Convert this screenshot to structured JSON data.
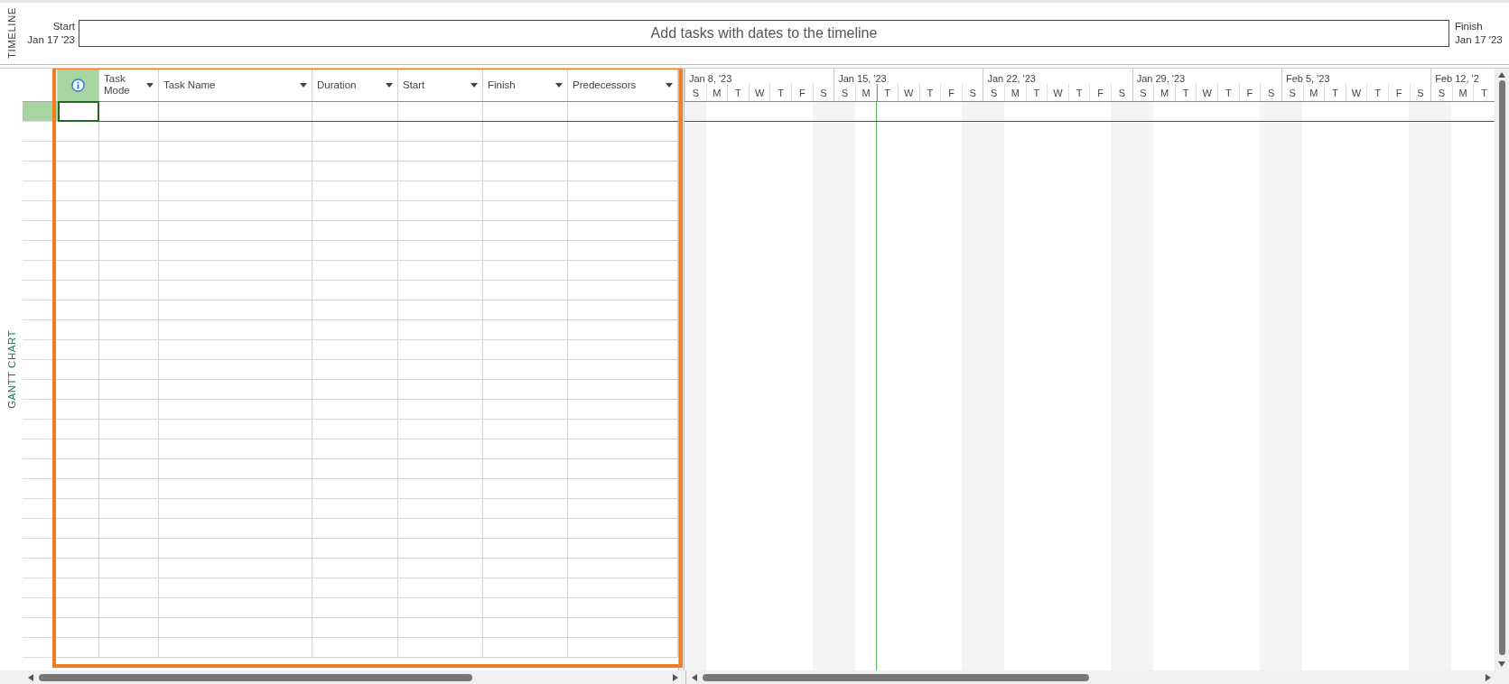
{
  "timeline": {
    "label": "TIMELINE",
    "start_label": "Start",
    "start_date": "Jan 17 '23",
    "placeholder": "Add tasks with dates to the timeline",
    "finish_label": "Finish",
    "finish_date": "Jan 17 '23"
  },
  "gantt": {
    "label": "GANTT CHART",
    "columns": [
      {
        "kind": "indicator"
      },
      {
        "kind": "field",
        "label": "Task Mode"
      },
      {
        "kind": "field",
        "label": "Task Name"
      },
      {
        "kind": "field",
        "label": "Duration"
      },
      {
        "kind": "field",
        "label": "Start"
      },
      {
        "kind": "field",
        "label": "Finish"
      },
      {
        "kind": "field",
        "label": "Predecessors"
      }
    ],
    "first_row": {
      "selected": true
    },
    "weeks": [
      {
        "label": "Jan 8, '23",
        "days": [
          {
            "label": "S",
            "today": false
          },
          {
            "label": "M",
            "today": false
          },
          {
            "label": "T",
            "today": false
          },
          {
            "label": "W",
            "today": false
          },
          {
            "label": "T",
            "today": false
          },
          {
            "label": "F",
            "today": false
          },
          {
            "label": "S",
            "today": false
          }
        ]
      },
      {
        "label": "Jan 15, '23",
        "days": [
          {
            "label": "S",
            "today": false
          },
          {
            "label": "M",
            "today": false
          },
          {
            "label": "T",
            "today": true
          },
          {
            "label": "W",
            "today": false
          },
          {
            "label": "T",
            "today": false
          },
          {
            "label": "F",
            "today": false
          },
          {
            "label": "S",
            "today": false
          }
        ]
      },
      {
        "label": "Jan 22, '23",
        "days": [
          {
            "label": "S",
            "today": false
          },
          {
            "label": "M",
            "today": false
          },
          {
            "label": "T",
            "today": false
          },
          {
            "label": "W",
            "today": false
          },
          {
            "label": "T",
            "today": false
          },
          {
            "label": "F",
            "today": false
          },
          {
            "label": "S",
            "today": false
          }
        ]
      },
      {
        "label": "Jan 29, '23",
        "days": [
          {
            "label": "S",
            "today": false
          },
          {
            "label": "M",
            "today": false
          },
          {
            "label": "T",
            "today": false
          },
          {
            "label": "W",
            "today": false
          },
          {
            "label": "T",
            "today": false
          },
          {
            "label": "F",
            "today": false
          },
          {
            "label": "S",
            "today": false
          }
        ]
      },
      {
        "label": "Feb 5, '23",
        "days": [
          {
            "label": "S",
            "today": false
          },
          {
            "label": "M",
            "today": false
          },
          {
            "label": "T",
            "today": false
          },
          {
            "label": "W",
            "today": false
          },
          {
            "label": "T",
            "today": false
          },
          {
            "label": "F",
            "today": false
          },
          {
            "label": "S",
            "today": false
          }
        ]
      },
      {
        "label": "Feb 12, '2",
        "days": [
          {
            "label": "S",
            "today": false
          },
          {
            "label": "M",
            "today": false
          },
          {
            "label": "T",
            "today": false
          }
        ]
      }
    ]
  }
}
